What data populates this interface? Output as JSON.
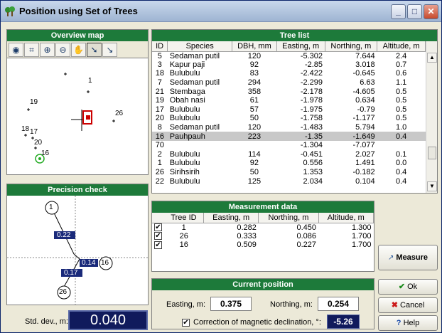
{
  "window": {
    "title": "Position using Set of Trees",
    "min": "_",
    "max": "□",
    "close": "✕"
  },
  "overview": {
    "title": "Overview map",
    "tools": [
      "globe-tool",
      "extent-tool",
      "zoom-in-tool",
      "zoom-out-tool",
      "pan-tool",
      "select-tool",
      "measure-line-tool"
    ],
    "tool_glyphs": [
      "◉",
      "⌗",
      "⊕",
      "⊖",
      "✋",
      "➘",
      "↘"
    ],
    "labels": [
      "1",
      "19",
      "26",
      "18",
      "17",
      "20",
      "16"
    ]
  },
  "precision": {
    "title": "Precision check",
    "nodes": [
      "1",
      "16",
      "26"
    ],
    "dists": [
      "0.22",
      "0.14",
      "0.17"
    ],
    "std_label": "Std. dev., m:",
    "std_value": "0.040"
  },
  "tree_list": {
    "title": "Tree list",
    "headers": [
      "ID",
      "Species",
      "DBH, mm",
      "Easting, m",
      "Northing, m",
      "Altitude, m"
    ],
    "rows": [
      [
        "5",
        "Sedaman putil",
        "120",
        "-5.302",
        "7.644",
        "2.4"
      ],
      [
        "3",
        "Kapur paji",
        "92",
        "-2.85",
        "3.018",
        "0.7"
      ],
      [
        "18",
        "Bulubulu",
        "83",
        "-2.422",
        "-0.645",
        "0.6"
      ],
      [
        "7",
        "Sedaman putil",
        "294",
        "-2.299",
        "6.63",
        "1.1"
      ],
      [
        "21",
        "Stembaga",
        "358",
        "-2.178",
        "-4.605",
        "0.5"
      ],
      [
        "19",
        "Obah nasi",
        "61",
        "-1.978",
        "0.634",
        "0.5"
      ],
      [
        "17",
        "Bulubulu",
        "57",
        "-1.975",
        "-0.79",
        "0.5"
      ],
      [
        "20",
        "Bulubulu",
        "50",
        "-1.758",
        "-1.177",
        "0.5"
      ],
      [
        "8",
        "Sedaman putil",
        "120",
        "-1.483",
        "5.794",
        "1.0"
      ],
      [
        "16",
        "Pauhpauh",
        "223",
        "-1.35",
        "-1.649",
        "0.4"
      ],
      [
        "70",
        "",
        "",
        "-1.304",
        "-7.077",
        ""
      ],
      [
        "2",
        "Bulubulu",
        "114",
        "-0.451",
        "2.027",
        "0.1"
      ],
      [
        "1",
        "Bulubulu",
        "92",
        "0.556",
        "1.491",
        "0.0"
      ],
      [
        "26",
        "Sirihsirih",
        "50",
        "1.353",
        "-0.182",
        "0.4"
      ],
      [
        "22",
        "Bulubulu",
        "125",
        "2.034",
        "0.104",
        "0.4"
      ]
    ],
    "selected_index": 9
  },
  "measurement": {
    "title": "Measurement data",
    "headers": [
      "Tree ID",
      "Easting, m",
      "Northing, m",
      "Altitude, m"
    ],
    "rows": [
      [
        "1",
        "0.282",
        "0.450",
        "1.300"
      ],
      [
        "26",
        "0.333",
        "0.086",
        "1.700"
      ],
      [
        "16",
        "0.509",
        "0.227",
        "1.700"
      ]
    ],
    "check": "✔"
  },
  "buttons": {
    "measure": "Measure",
    "ok": "Ok",
    "cancel": "Cancel",
    "help": "Help"
  },
  "current": {
    "title": "Current position",
    "easting_label": "Easting, m:",
    "easting": "0.375",
    "northing_label": "Northing, m:",
    "northing": "0.254",
    "decl_label": "Correction of magnetic declination, °:",
    "decl_value": "-5.26",
    "decl_checked": "✔"
  }
}
